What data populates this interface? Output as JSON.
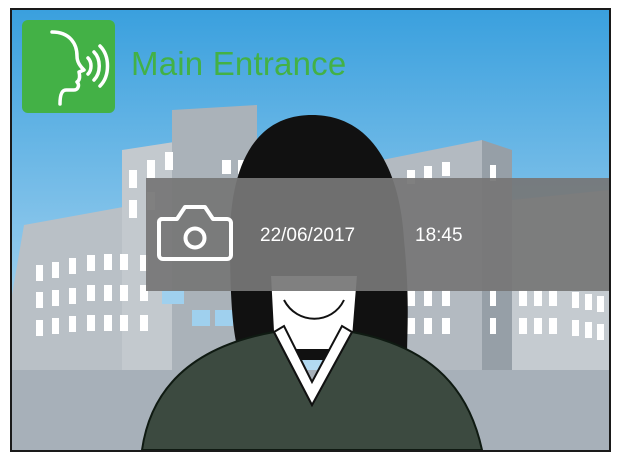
{
  "header": {
    "location_label": "Main Entrance",
    "status_icon": "speaking-head-icon"
  },
  "snapshot": {
    "icon": "camera-icon",
    "date": "22/06/2017",
    "time": "18:45"
  },
  "colors": {
    "accent": "#43b146",
    "sky": "#4ba8e0",
    "overlay": "#767676",
    "text_on_overlay": "#ffffff"
  }
}
